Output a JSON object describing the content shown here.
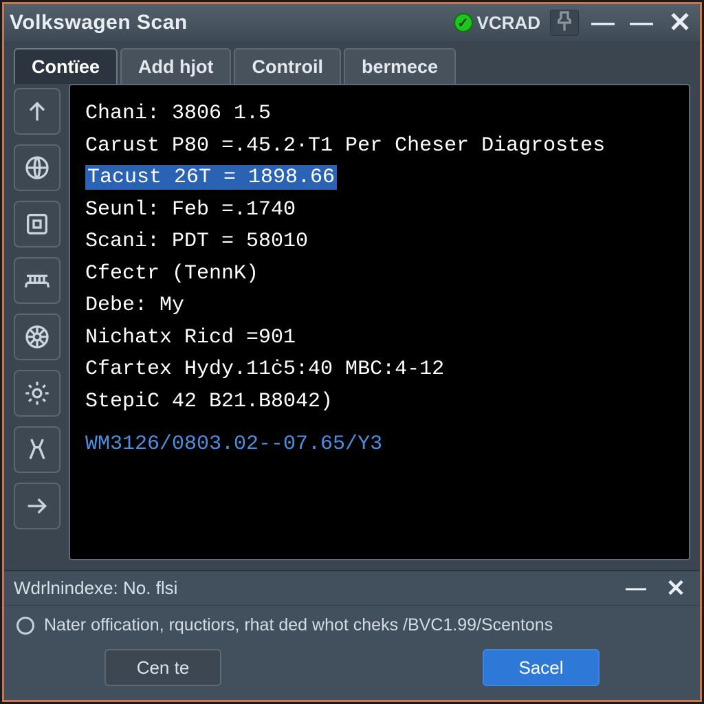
{
  "window": {
    "title": "Volkswagen Scan",
    "status_label": "VCRAD"
  },
  "tabs": [
    {
      "label": "Contïee"
    },
    {
      "label": "Add hjot"
    },
    {
      "label": "Controil"
    },
    {
      "label": "bermece"
    }
  ],
  "console": {
    "lines": [
      "Chani: 3806 1.5",
      "Carust P80 =.45.2·T1 Per Cheser Diagrostes",
      "Tacust 26T = 1898.66",
      "Seunl: Feb =.1740",
      "Scani: PDT = 58010",
      "Cfectr (TennK)",
      "Debe: My",
      "Nichatx Ricd =901",
      "Cfartex Hydy.11ċ5:40 MBC:4-12",
      "StepiC 42 B21.B8042)"
    ],
    "highlight_index": 2,
    "path": "WM3126/0803.02--07.65/Y3"
  },
  "sub": {
    "title": "Wdrlnindexe:  No. flsi",
    "message": "Nater offication, rquctiors, rhat ded whot cheks /BVC1.99/Scentons",
    "btn_center": "Cen te",
    "btn_save": "Sacel"
  },
  "icons": {
    "tool_up": "arrow-up",
    "tool_globe": "globe",
    "tool_frame": "frame",
    "tool_bridge": "bridge",
    "tool_wheel": "wheel",
    "tool_gear": "gear",
    "tool_fork": "fork",
    "tool_right": "arrow-right"
  }
}
